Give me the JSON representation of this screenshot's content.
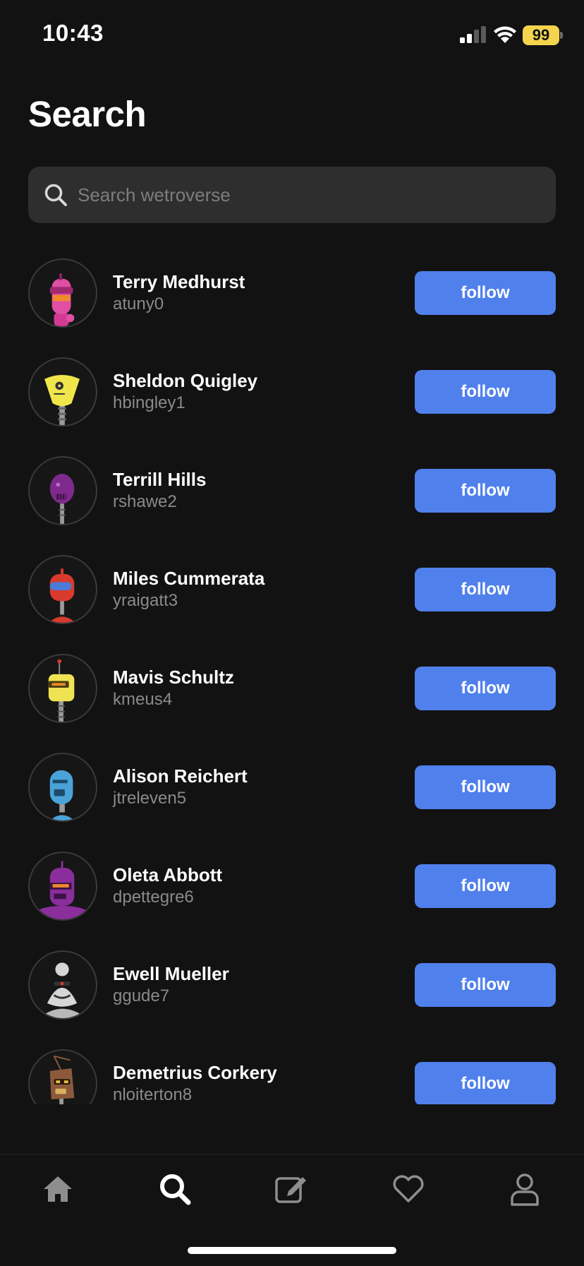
{
  "status_bar": {
    "time": "10:43",
    "battery": "99",
    "battery_color": "#f4d44e"
  },
  "page": {
    "title": "Search"
  },
  "search": {
    "placeholder": "Search wetroverse",
    "value": "",
    "icon": "search-icon"
  },
  "users": [
    {
      "name": "Terry Medhurst",
      "handle": "atuny0",
      "button": "follow",
      "avatar": "pink-robot-avatar"
    },
    {
      "name": "Sheldon Quigley",
      "handle": "hbingley1",
      "button": "follow",
      "avatar": "yellow-robot-avatar"
    },
    {
      "name": "Terrill Hills",
      "handle": "rshawe2",
      "button": "follow",
      "avatar": "purple-robot-avatar"
    },
    {
      "name": "Miles Cummerata",
      "handle": "yraigatt3",
      "button": "follow",
      "avatar": "red-robot-avatar"
    },
    {
      "name": "Mavis Schultz",
      "handle": "kmeus4",
      "button": "follow",
      "avatar": "yellow-antenna-robot-avatar"
    },
    {
      "name": "Alison Reichert",
      "handle": "jtreleven5",
      "button": "follow",
      "avatar": "blue-robot-avatar"
    },
    {
      "name": "Oleta Abbott",
      "handle": "dpettegre6",
      "button": "follow",
      "avatar": "purple-hat-robot-avatar"
    },
    {
      "name": "Ewell Mueller",
      "handle": "ggude7",
      "button": "follow",
      "avatar": "gray-robot-avatar"
    },
    {
      "name": "Demetrius Corkery",
      "handle": "nloiterton8",
      "button": "follow",
      "avatar": "brown-robot-avatar"
    }
  ],
  "tab_bar": {
    "tabs": [
      {
        "icon": "home-icon",
        "active": false
      },
      {
        "icon": "search-icon",
        "active": true
      },
      {
        "icon": "compose-icon",
        "active": false
      },
      {
        "icon": "heart-icon",
        "active": false
      },
      {
        "icon": "profile-icon",
        "active": false
      }
    ]
  },
  "colors": {
    "background": "#121212",
    "accent": "#5080ec",
    "muted_text": "#8a8a8a",
    "search_bg": "#2e2e2e"
  }
}
